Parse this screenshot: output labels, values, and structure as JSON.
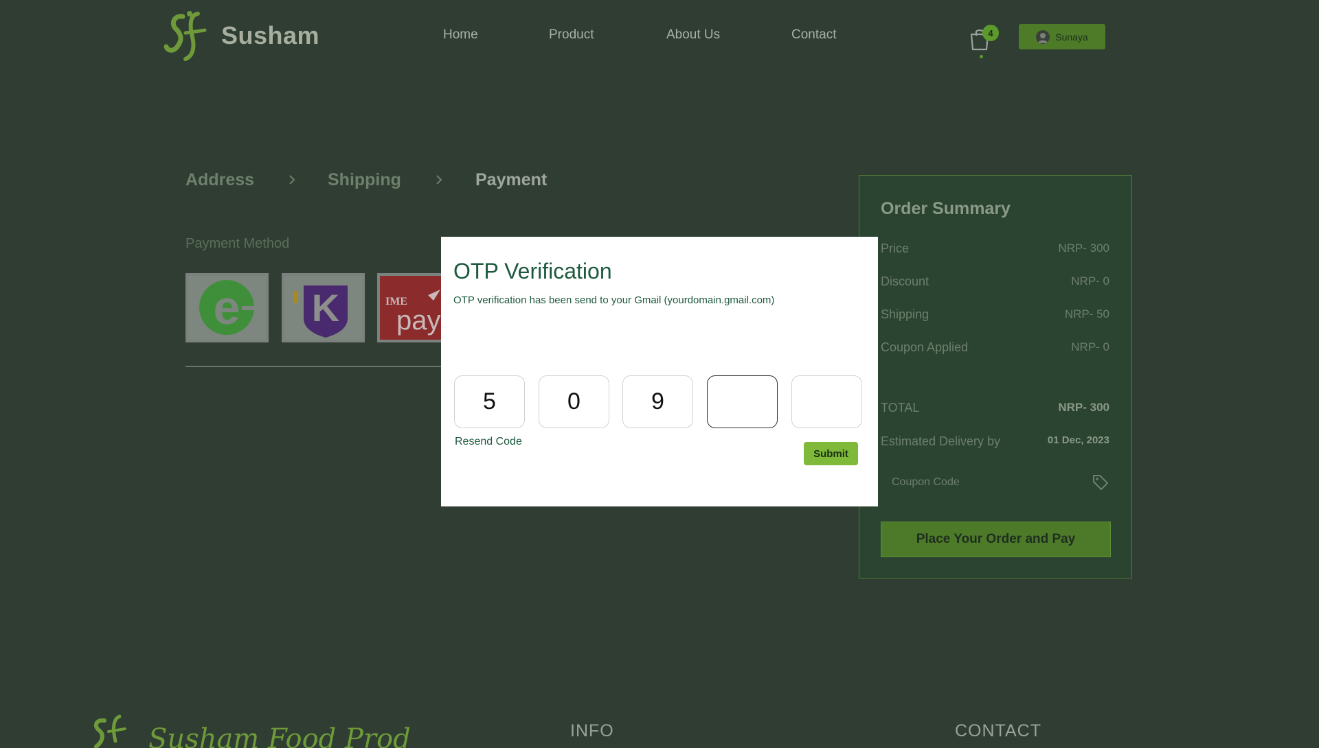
{
  "header": {
    "brand": "Susham",
    "nav": [
      "Home",
      "Product",
      "About Us",
      "Contact"
    ],
    "cart_count": "4",
    "user_name": "Sunaya"
  },
  "steps": [
    "Address",
    "Shipping",
    "Payment"
  ],
  "payment": {
    "label": "Payment Method",
    "methods": [
      "esewa-icon",
      "khalti-icon",
      "imepay-icon"
    ],
    "ime_text": "IME",
    "pay_text": "pay",
    "esewa_letter": "e",
    "khalti_letter": "K"
  },
  "summary": {
    "title": "Order Summary",
    "rows": [
      {
        "label": "Price",
        "value": "NRP- 300"
      },
      {
        "label": "Discount",
        "value": "NRP- 0"
      },
      {
        "label": "Shipping",
        "value": "NRP- 50"
      },
      {
        "label": "Coupon Applied",
        "value": "NRP- 0"
      }
    ],
    "total_label": "TOTAL",
    "total_value": "NRP- 300",
    "delivery_label": "Estimated Delivery by",
    "delivery_value": "01 Dec, 2023",
    "coupon_placeholder": "Coupon Code",
    "place_order": "Place Your Order and Pay"
  },
  "modal": {
    "title": "OTP Verification",
    "description": "OTP verification has been send to your Gmail (yourdomain.gmail.com)",
    "digits": [
      "5",
      "0",
      "9",
      "",
      ""
    ],
    "resend": "Resend Code",
    "submit": "Submit"
  },
  "footer": {
    "tagline": "Susham Food Products",
    "info": "INFO",
    "contact": "CONTACT"
  },
  "colors": {
    "background": "#2f3d33",
    "accent": "#7eb93a",
    "modal_text": "#1d5a3d"
  }
}
